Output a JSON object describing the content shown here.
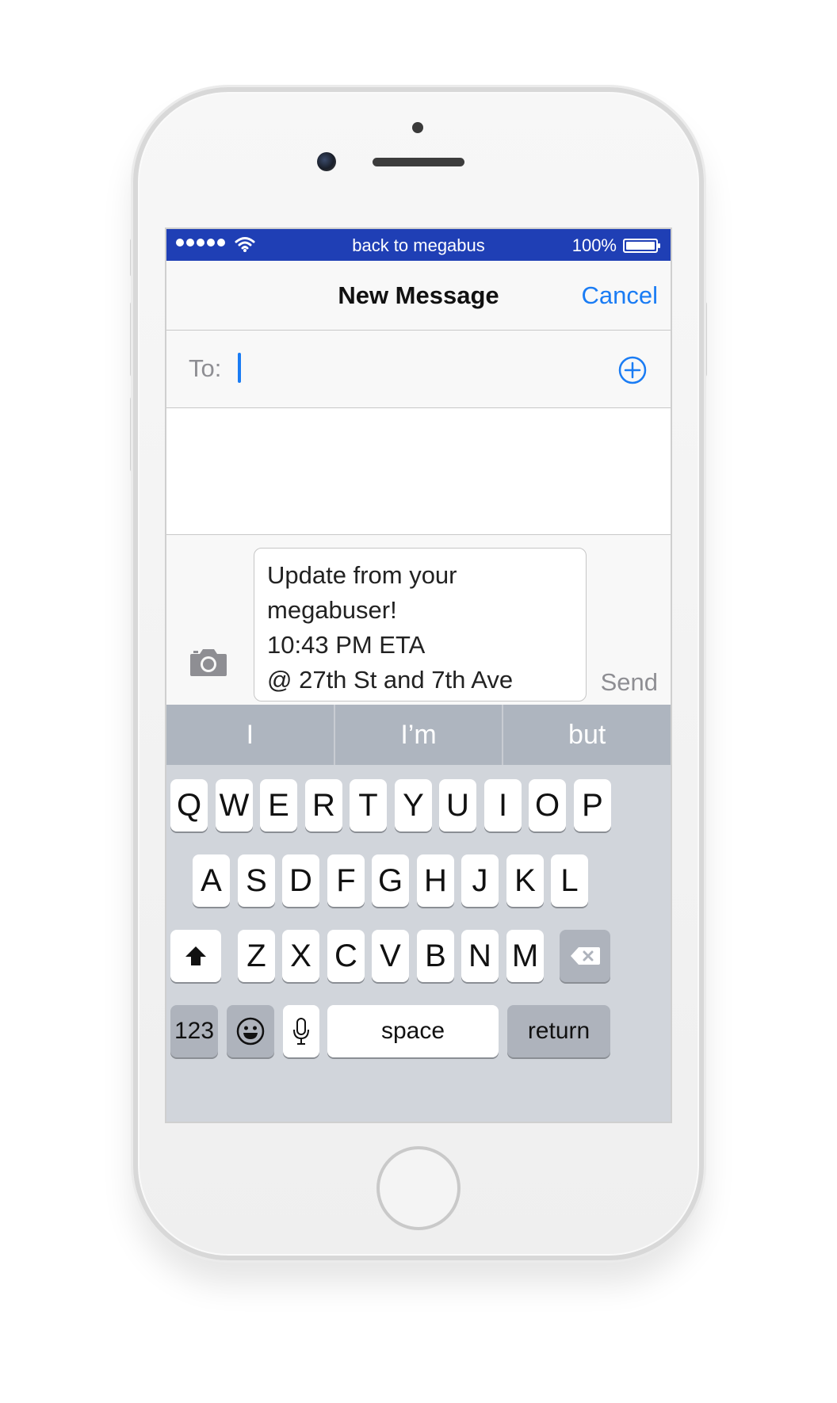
{
  "status_bar": {
    "carrier_signal": "●●●●●",
    "title": "back to megabus",
    "battery_percent": "100%",
    "signal_icon": "signal-dots-icon",
    "wifi_icon": "wifi-icon",
    "battery_icon": "battery-icon",
    "background_color": "#1f3fb5"
  },
  "nav": {
    "title": "New Message",
    "cancel_label": "Cancel",
    "accent_color": "#1a7cf4"
  },
  "recipient": {
    "label": "To:",
    "value": "",
    "add_icon": "plus-circle-icon"
  },
  "compose": {
    "camera_icon": "camera-icon",
    "message_lines": [
      "Update from your",
      "megabuser!",
      "10:43 PM ETA",
      "@ 27th St and 7th Ave"
    ],
    "send_label": "Send"
  },
  "keyboard": {
    "suggestions": [
      "I",
      "I’m",
      "but"
    ],
    "row1": [
      "Q",
      "W",
      "E",
      "R",
      "T",
      "Y",
      "U",
      "I",
      "O",
      "P"
    ],
    "row2": [
      "A",
      "S",
      "D",
      "F",
      "G",
      "H",
      "J",
      "K",
      "L"
    ],
    "row3": [
      "Z",
      "X",
      "C",
      "V",
      "B",
      "N",
      "M"
    ],
    "shift_icon": "shift-arrow-icon",
    "delete_icon": "backspace-icon",
    "numbers_label": "123",
    "emoji_icon": "emoji-icon",
    "mic_icon": "microphone-icon",
    "space_label": "space",
    "return_label": "return"
  }
}
